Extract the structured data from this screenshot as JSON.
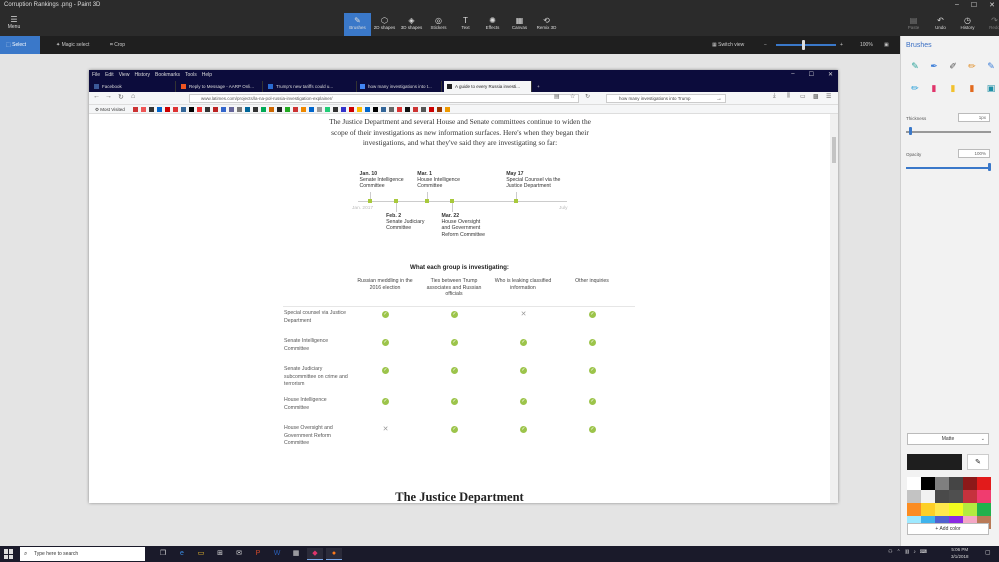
{
  "app": {
    "window_title": "Corruption Rankings .png - Paint 3D",
    "menu_label": "Menu",
    "tools": [
      {
        "label": "Brushes",
        "icon": "brush-icon",
        "active": true
      },
      {
        "label": "2D shapes",
        "icon": "shapes-2d-icon"
      },
      {
        "label": "3D shapes",
        "icon": "shapes-3d-icon"
      },
      {
        "label": "Stickers",
        "icon": "sticker-icon"
      },
      {
        "label": "Text",
        "icon": "text-icon"
      },
      {
        "label": "Effects",
        "icon": "effects-icon"
      },
      {
        "label": "Canvas",
        "icon": "canvas-icon"
      },
      {
        "label": "Remix 3D",
        "icon": "remix-icon"
      }
    ],
    "right_tools": [
      "Paste",
      "Undo",
      "History",
      "Redo"
    ],
    "secondary": {
      "select": "Select",
      "magic_select": "Magic select",
      "crop": "Crop",
      "switch_view": "Switch view",
      "zoom": "100%"
    }
  },
  "brushes_panel": {
    "title": "Brushes",
    "thickness_label": "Thickness",
    "thickness_value": "1px",
    "opacity_label": "Opacity",
    "opacity_value": "100%",
    "finish": "Matte",
    "add_color": "Add color",
    "palette": [
      "#ffffff",
      "#000000",
      "#7f7f7f",
      "#454545",
      "#8c1919",
      "#e21b1b",
      "#c3c3c3",
      "#f2f2f2",
      "#4a4a4a",
      "#4f4f4f",
      "#c5323d",
      "#f03c6f",
      "#fb8c22",
      "#fdcf27",
      "#ffe84c",
      "#f2fb1f",
      "#b3ea40",
      "#22b14c",
      "#9ee9ff",
      "#3fb3ec",
      "#5061cf",
      "#8a2be2",
      "#f4a7c5",
      "#b97a57"
    ]
  },
  "browser": {
    "menu": [
      "File",
      "Edit",
      "View",
      "History",
      "Bookmarks",
      "Tools",
      "Help"
    ],
    "tabs": [
      {
        "title": "Facebook",
        "color": "#3b5998"
      },
      {
        "title": "Reply to Message - AARP Onli...",
        "color": "#e52"
      },
      {
        "title": "Trump's new tariffs could u...",
        "color": "#2a6bd1"
      },
      {
        "title": "how many investigations into t...",
        "color": "#4285f4"
      },
      {
        "title": "A guide to every Russia investi...",
        "color": "#222",
        "active": true
      }
    ],
    "url": "www.latimes.com/projects/la-na-pol-russia-investigation-explainer/",
    "search": "how many investigations into Trump",
    "bookmarks_label": "Most Visited"
  },
  "article": {
    "intro": "The Justice Department and several House and Senate committees continue to widen the scope of their investigations as new information surfaces. Here's when they began their investigations, and what they've said they are investigating so far:",
    "timeline": {
      "start_label": "Jan. 2017",
      "end_label": "July",
      "events": [
        {
          "date": "Jan. 10",
          "name": "Senate Intelligence Committee",
          "day": 10,
          "side": "above"
        },
        {
          "date": "Feb. 2",
          "name": "Senate Judiciary Committee",
          "day": 33,
          "side": "below"
        },
        {
          "date": "Mar. 1",
          "name": "House Intelligence Committee",
          "day": 60,
          "side": "above"
        },
        {
          "date": "Mar. 22",
          "name": "House Oversight and Government Reform Committee",
          "day": 81,
          "side": "below"
        },
        {
          "date": "May 17",
          "name": "Special Counsel via the Justice Department",
          "day": 137,
          "side": "above"
        }
      ]
    },
    "table": {
      "title": "What each group is investigating:",
      "columns": [
        "Russian meddling in the 2016 election",
        "Ties between Trump associates and Russian officials",
        "Who is leaking classified information",
        "Other inquiries"
      ],
      "rows": [
        {
          "group": "Special counsel via Justice Department",
          "values": [
            true,
            true,
            false,
            true
          ]
        },
        {
          "group": "Senate Intelligence Committee",
          "values": [
            true,
            true,
            true,
            true
          ]
        },
        {
          "group": "Senate Judiciary subcommittee on crime and terrorism",
          "values": [
            true,
            true,
            true,
            true
          ]
        },
        {
          "group": "House Intelligence Committee",
          "values": [
            true,
            true,
            true,
            true
          ]
        },
        {
          "group": "House Oversight and Government Reform Committee",
          "values": [
            false,
            true,
            true,
            true
          ]
        }
      ]
    },
    "next_heading": "The Justice Department"
  },
  "taskbar": {
    "search_placeholder": "Type here to search",
    "time": "5:06 PM",
    "date": "3/1/2018"
  }
}
